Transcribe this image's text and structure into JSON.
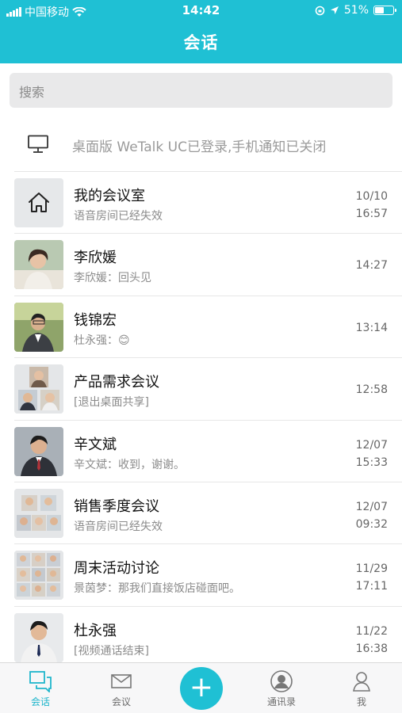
{
  "status_bar": {
    "carrier": "中国移动",
    "time": "14:42",
    "battery": "51%",
    "battery_level": 0.51
  },
  "header": {
    "title": "会话"
  },
  "search": {
    "placeholder": "搜索"
  },
  "notice": {
    "text": "桌面版 WeTalk UC已登录,手机通知已关闭"
  },
  "conversations": [
    {
      "name": "我的会议室",
      "preview": "语音房间已经失效",
      "date": "10/10",
      "time": "16:57",
      "avatar": "home-icon"
    },
    {
      "name": "李欣媛",
      "preview": "李欣媛：回头见",
      "date": "",
      "time": "14:27",
      "avatar": "person"
    },
    {
      "name": "钱锦宏",
      "preview": "杜永强：😊",
      "date": "",
      "time": "13:14",
      "avatar": "person"
    },
    {
      "name": "产品需求会议",
      "preview": "[退出桌面共享]",
      "date": "",
      "time": "12:58",
      "avatar": "group"
    },
    {
      "name": "辛文斌",
      "preview": "辛文斌：收到，谢谢。",
      "date": "12/07",
      "time": "15:33",
      "avatar": "person"
    },
    {
      "name": "销售季度会议",
      "preview": "语音房间已经失效",
      "date": "12/07",
      "time": "09:32",
      "avatar": "group"
    },
    {
      "name": "周末活动讨论",
      "preview": "景茵梦：那我们直接饭店碰面吧。",
      "date": "11/29",
      "time": "17:11",
      "avatar": "group"
    },
    {
      "name": "杜永强",
      "preview": "[视频通话结束]",
      "date": "11/22",
      "time": "16:38",
      "avatar": "person"
    }
  ],
  "tabbar": {
    "tabs": [
      {
        "label": "会话",
        "icon": "chat-icon",
        "active": true
      },
      {
        "label": "会议",
        "icon": "envelope-icon"
      },
      {
        "label": "通讯录",
        "icon": "contacts-icon"
      },
      {
        "label": "我",
        "icon": "profile-icon"
      }
    ],
    "add": "+"
  },
  "colors": {
    "accent": "#1fc0d4",
    "tab_active": "#1fb6cb"
  }
}
